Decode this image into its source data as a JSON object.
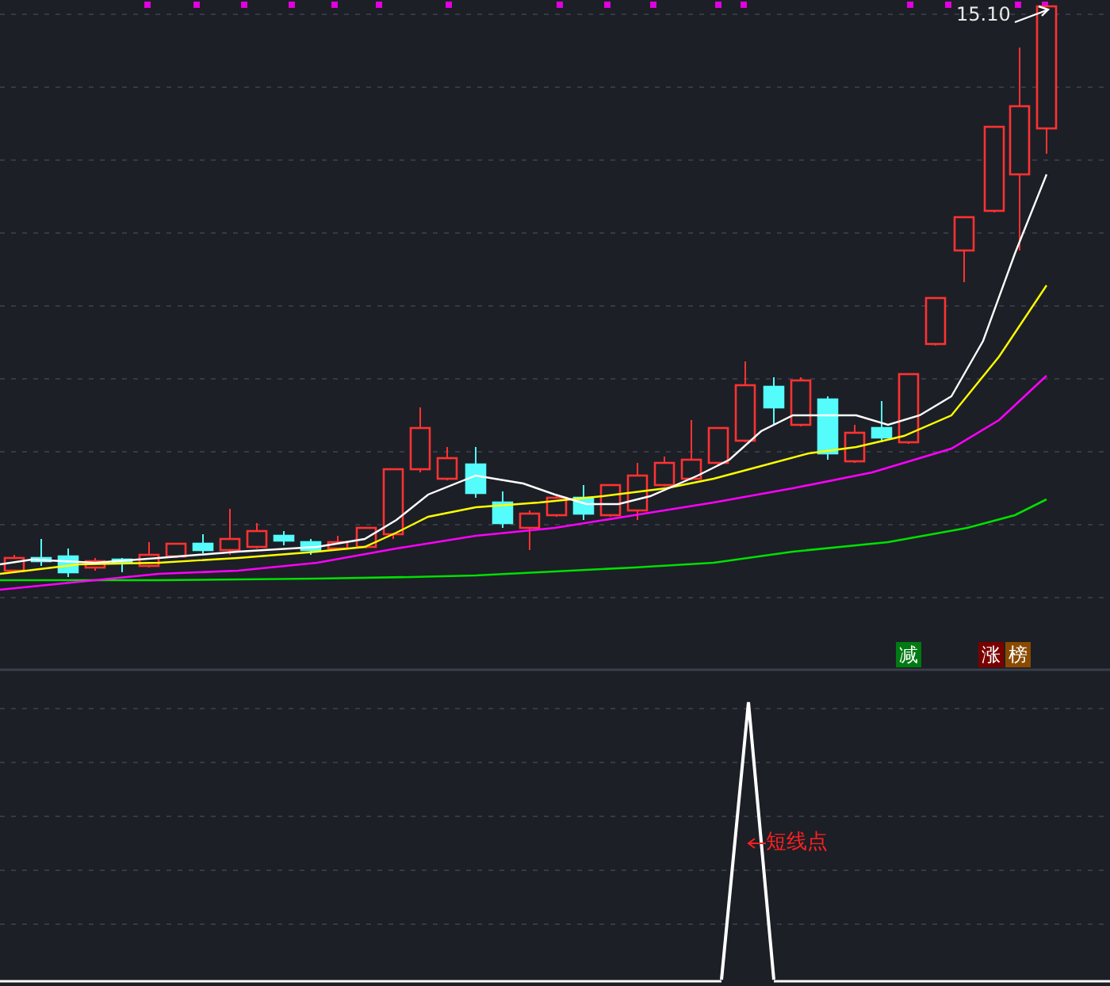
{
  "price_chart": {
    "high_label": "15.10",
    "signal_tags": [
      {
        "label": "减",
        "color": "#007a12"
      },
      {
        "label": "涨",
        "color": "#7a0000"
      },
      {
        "label": "榜",
        "color": "#8a4a00"
      }
    ]
  },
  "indicator_panel": {
    "annotation": "短线点"
  }
}
